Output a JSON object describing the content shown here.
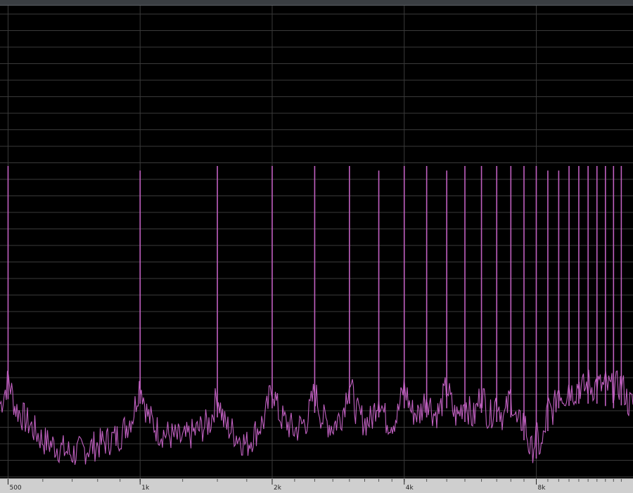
{
  "colors": {
    "background": "#000000",
    "grid": "#3a3a3a",
    "trace": "#c060c0",
    "axis_bar": "#cfcfcf",
    "axis_text": "#222222"
  },
  "chart_data": {
    "type": "line",
    "title": "",
    "xlabel": "",
    "ylabel": "",
    "x_scale": "log",
    "xlim": [
      490,
      13000
    ],
    "ylim": [
      0,
      1
    ],
    "grid": true,
    "x_ticks": [
      {
        "value": 500,
        "label": "500"
      },
      {
        "value": 1000,
        "label": "1k"
      },
      {
        "value": 2000,
        "label": "2k"
      },
      {
        "value": 4000,
        "label": "4k"
      },
      {
        "value": 8000,
        "label": "8k"
      }
    ],
    "fundamental_hz": 500,
    "harmonic_peaks": [
      {
        "freq": 500,
        "level": 0.68
      },
      {
        "freq": 1000,
        "level": 0.67
      },
      {
        "freq": 1500,
        "level": 0.68
      },
      {
        "freq": 2000,
        "level": 0.68
      },
      {
        "freq": 2500,
        "level": 0.68
      },
      {
        "freq": 3000,
        "level": 0.68
      },
      {
        "freq": 3500,
        "level": 0.67
      },
      {
        "freq": 4000,
        "level": 0.68
      },
      {
        "freq": 4500,
        "level": 0.68
      },
      {
        "freq": 5000,
        "level": 0.67
      },
      {
        "freq": 5500,
        "level": 0.68
      },
      {
        "freq": 6000,
        "level": 0.68
      },
      {
        "freq": 6500,
        "level": 0.68
      },
      {
        "freq": 7000,
        "level": 0.68
      },
      {
        "freq": 7500,
        "level": 0.68
      },
      {
        "freq": 8000,
        "level": 0.68
      },
      {
        "freq": 8500,
        "level": 0.67
      },
      {
        "freq": 9000,
        "level": 0.67
      },
      {
        "freq": 9500,
        "level": 0.68
      },
      {
        "freq": 10000,
        "level": 0.68
      },
      {
        "freq": 10500,
        "level": 0.68
      },
      {
        "freq": 11000,
        "level": 0.68
      },
      {
        "freq": 11500,
        "level": 0.68
      },
      {
        "freq": 12000,
        "level": 0.68
      },
      {
        "freq": 12500,
        "level": 0.68
      }
    ],
    "noise_floor": {
      "freq": [
        500,
        600,
        700,
        800,
        900,
        1000,
        1100,
        1250,
        1500,
        1750,
        2000,
        2250,
        2500,
        2750,
        3000,
        3250,
        3500,
        3750,
        4000,
        4500,
        5000,
        5500,
        6000,
        6500,
        7000,
        7500,
        7800,
        8200,
        8500,
        9000,
        10000,
        11000,
        12000,
        12800
      ],
      "level": [
        0.17,
        0.08,
        0.05,
        0.07,
        0.09,
        0.16,
        0.1,
        0.08,
        0.13,
        0.07,
        0.15,
        0.1,
        0.14,
        0.11,
        0.16,
        0.12,
        0.13,
        0.12,
        0.15,
        0.13,
        0.15,
        0.12,
        0.14,
        0.12,
        0.13,
        0.08,
        0.04,
        0.04,
        0.1,
        0.15,
        0.16,
        0.16,
        0.15,
        0.16
      ]
    }
  }
}
